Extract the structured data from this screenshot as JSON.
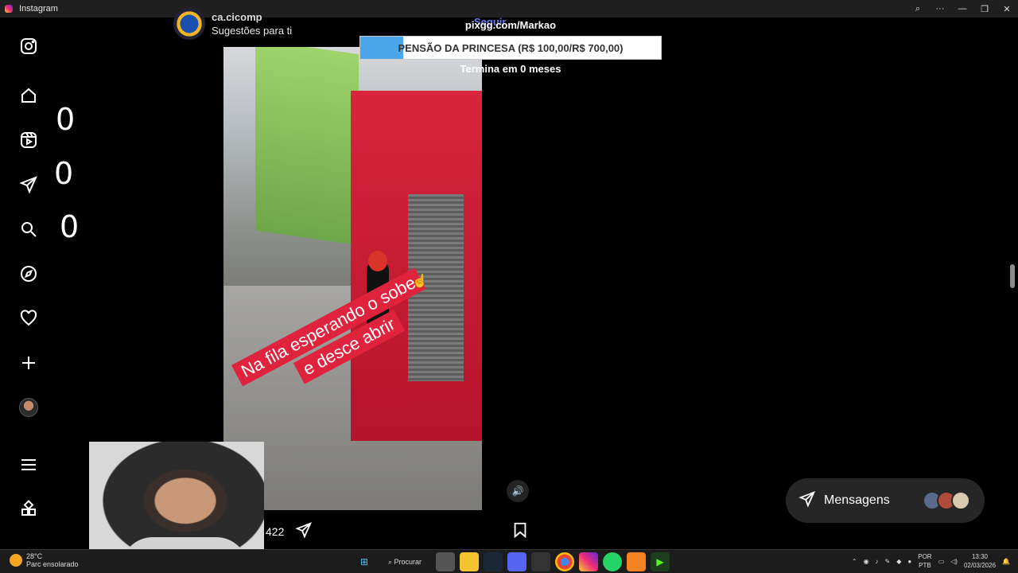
{
  "window": {
    "title": "Instagram",
    "controls": [
      "⌕",
      "···",
      "—",
      "❐",
      "✕"
    ]
  },
  "overlay_counters": [
    "0",
    "0",
    "0"
  ],
  "post": {
    "username": "ca.cicomp",
    "subtitle": "Sugestões para ti",
    "follow_label": "Seguir",
    "video_caption_line1": "Na fila esperando o sobe",
    "video_caption_line2": "e desce abrir",
    "like_count": "422"
  },
  "donation": {
    "url": "pixgg.com/Markao",
    "goal_label": "PENSÃO DA PRINCESA (R$ 100,00/R$ 700,00)",
    "ends_label": "Termina em 0 meses",
    "progress": 0.143,
    "fill_color": "#4aa6e8"
  },
  "messages": {
    "label": "Mensagens"
  },
  "taskbar": {
    "temperature": "28°C",
    "weather_desc": "Parc ensolarado",
    "search_label": "Procurar",
    "lang_line1": "POR",
    "lang_line2": "PTB",
    "time": "13:30",
    "date": "02/03/2026"
  },
  "colors": {
    "accent": "#0095f6",
    "banner_red": "#e0233d"
  }
}
